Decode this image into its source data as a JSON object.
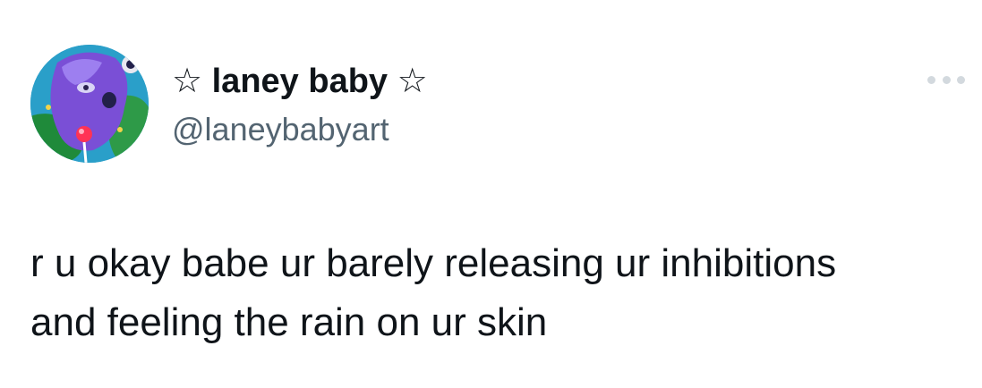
{
  "tweet": {
    "display_name": "☆ laney baby ☆",
    "handle": "@laneybabyart",
    "text_lines": [
      "r u okay babe ur barely releasing ur inhibitions",
      "and feeling the rain on ur skin"
    ],
    "more_icon": "more-horizontal-icon",
    "avatar_icon": "avatar"
  },
  "colors": {
    "text": "#0f1419",
    "handle": "#536471",
    "more_dots": "#d3d9de"
  }
}
